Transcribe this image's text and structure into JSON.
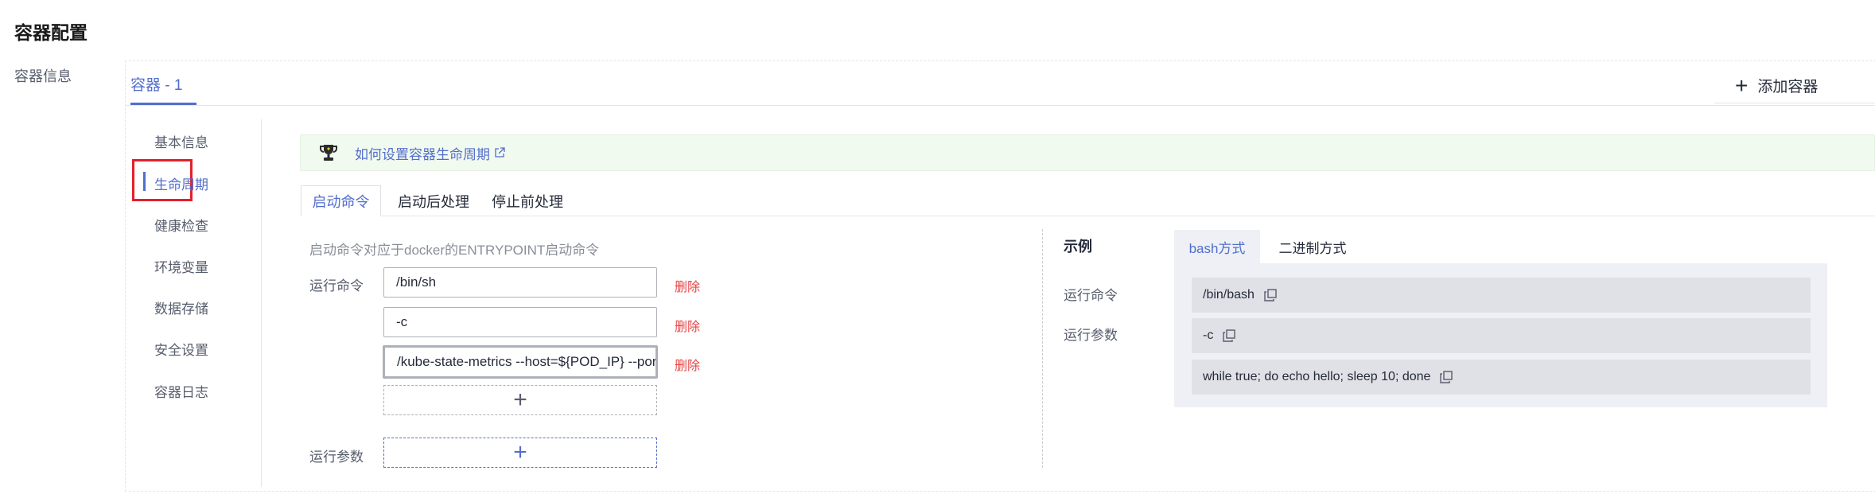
{
  "page": {
    "title": "容器配置",
    "section_label": "容器信息"
  },
  "container_tabs": {
    "active": "容器 - 1",
    "add_label": "添加容器"
  },
  "sidebar": {
    "items": [
      {
        "label": "基本信息"
      },
      {
        "label": "生命周期"
      },
      {
        "label": "健康检查"
      },
      {
        "label": "环境变量"
      },
      {
        "label": "数据存储"
      },
      {
        "label": "安全设置"
      },
      {
        "label": "容器日志"
      }
    ],
    "active_index": 1
  },
  "tip": {
    "text": "如何设置容器生命周期",
    "icon": "trophy-icon"
  },
  "lifecycle_tabs": {
    "items": [
      "启动命令",
      "启动后处理",
      "停止前处理"
    ],
    "active_index": 0
  },
  "startup": {
    "description": "启动命令对应于docker的ENTRYPOINT启动命令",
    "command_label": "运行命令",
    "args_label": "运行参数",
    "delete_label": "删除",
    "commands": [
      "/bin/sh",
      "-c",
      "/kube-state-metrics --host=${POD_IP} --por"
    ]
  },
  "example": {
    "title": "示例",
    "tabs": [
      "bash方式",
      "二进制方式"
    ],
    "active_tab": 0,
    "command_label": "运行命令",
    "args_label": "运行参数",
    "values": [
      "/bin/bash",
      "-c",
      "while true; do echo hello; sleep 10; done"
    ]
  },
  "colors": {
    "accent": "#526ecc",
    "danger": "#e54545",
    "highlight": "#e41f2b",
    "tip_bg": "#f1faef"
  }
}
